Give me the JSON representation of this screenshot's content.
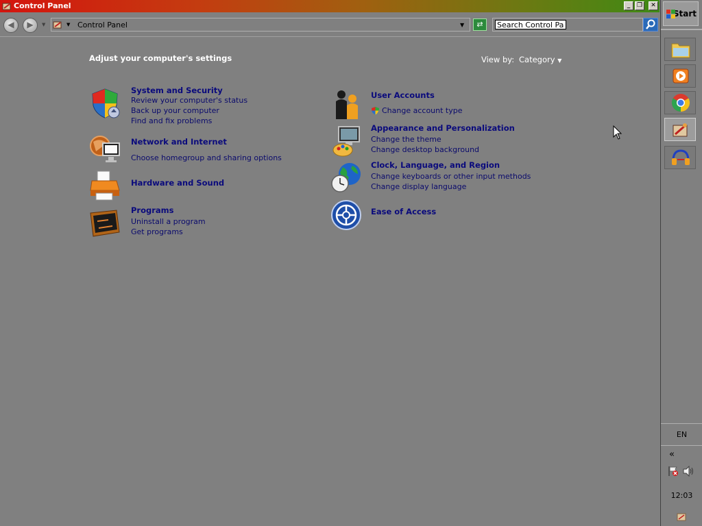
{
  "window": {
    "title": "Control Panel",
    "buttons": [
      "minimize",
      "restore",
      "close"
    ]
  },
  "toolbar": {
    "address_text": "Control Panel",
    "search_placeholder": "Search Control Panel"
  },
  "main": {
    "heading": "Adjust your computer's settings",
    "view_by_label": "View by:",
    "view_by_value": "Category",
    "categories": [
      {
        "title": "System and Security",
        "icon": "shield-icon",
        "links": [
          "Review your computer's status",
          "Back up your computer",
          "Find and fix problems"
        ]
      },
      {
        "title": "Network and Internet",
        "icon": "network-icon",
        "links": [
          "Choose homegroup and sharing options"
        ]
      },
      {
        "title": "Hardware and Sound",
        "icon": "printer-icon",
        "links": []
      },
      {
        "title": "Programs",
        "icon": "programs-icon",
        "links": [
          "Uninstall a program",
          "Get programs"
        ]
      },
      {
        "title": "User Accounts",
        "icon": "users-icon",
        "links": [
          "Change account type"
        ]
      },
      {
        "title": "Appearance and Personalization",
        "icon": "appearance-icon",
        "links": [
          "Change the theme",
          "Change desktop background"
        ]
      },
      {
        "title": "Clock, Language, and Region",
        "icon": "clock-globe-icon",
        "links": [
          "Change keyboards or other input methods",
          "Change display language"
        ]
      },
      {
        "title": "Ease of Access",
        "icon": "ease-of-access-icon",
        "links": []
      }
    ]
  },
  "taskbar": {
    "start_label": "Start",
    "pinned": [
      "file-explorer-icon",
      "media-player-icon",
      "chrome-icon",
      "control-panel-icon",
      "headphones-icon"
    ],
    "language": "EN",
    "tray_expand": "«",
    "clock": "12:03"
  }
}
